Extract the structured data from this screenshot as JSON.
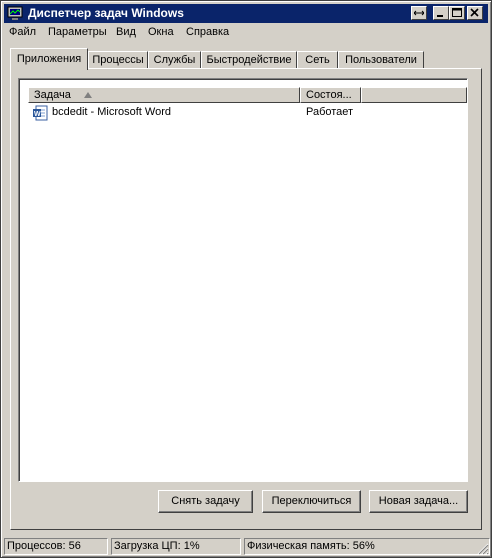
{
  "window": {
    "title": "Диспетчер задач Windows",
    "icon": "task-manager-icon",
    "controls": [
      "restore-resize-icon",
      "minimize-icon",
      "maximize-icon",
      "close-icon"
    ]
  },
  "menu": {
    "file": "Файл",
    "options": "Параметры",
    "view": "Вид",
    "windows": "Окна",
    "help": "Справка"
  },
  "tabs": {
    "applications": "Приложения",
    "processes": "Процессы",
    "services": "Службы",
    "performance": "Быстродействие",
    "networking": "Сеть",
    "users": "Пользователи"
  },
  "task_list": {
    "columns": {
      "task": "Задача",
      "status": "Состоя..."
    },
    "rows": [
      {
        "icon": "word-document-icon",
        "task": "bcdedit - Microsoft Word",
        "status": "Работает"
      }
    ]
  },
  "buttons": {
    "end_task": "Снять задачу",
    "switch_to": "Переключиться",
    "new_task": "Новая задача..."
  },
  "status": {
    "processes": "Процессов: 56",
    "cpu": "Загрузка ЦП: 1%",
    "memory": "Физическая память: 56%"
  }
}
